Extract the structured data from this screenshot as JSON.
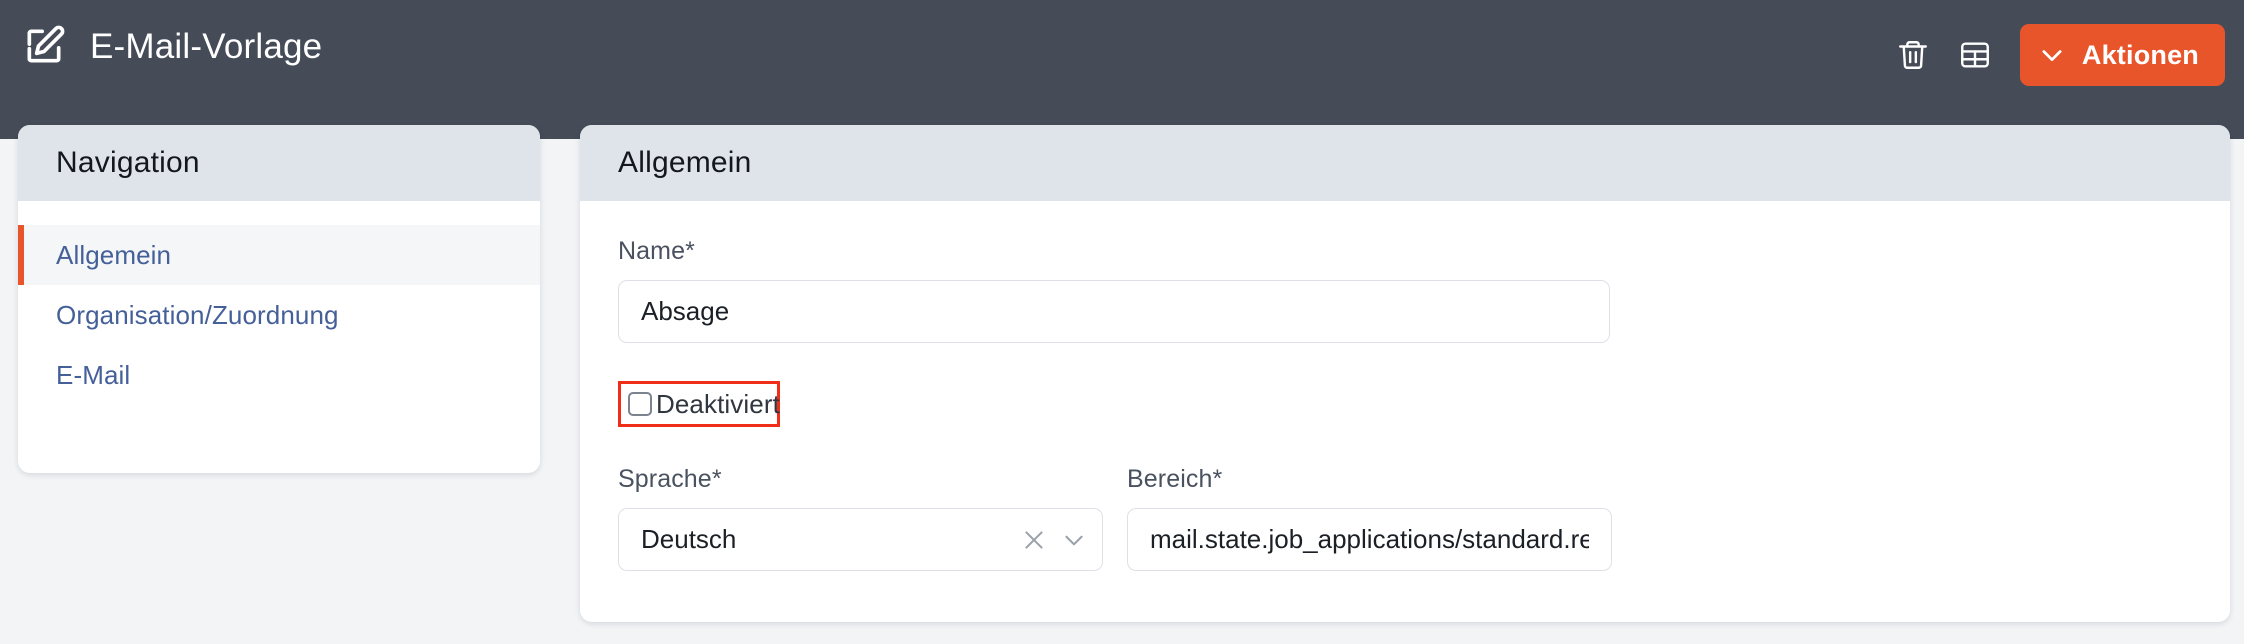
{
  "header": {
    "title": "E-Mail-Vorlage",
    "edit_icon": "edit-square-icon",
    "delete_icon": "trash-icon",
    "table_icon": "table-icon",
    "actions_label": "Aktionen",
    "actions_chevron_icon": "chevron-down-icon",
    "background_color": "#454c58",
    "accent_color": "#e8552a"
  },
  "navigation": {
    "title": "Navigation",
    "items": [
      {
        "label": "Allgemein",
        "active": true
      },
      {
        "label": "Organisation/Zuordnung",
        "active": false
      },
      {
        "label": "E-Mail",
        "active": false
      }
    ],
    "active_indicator_color": "#e8552a",
    "link_color": "#456099"
  },
  "main": {
    "title": "Allgemein",
    "fields": {
      "name": {
        "label": "Name*",
        "value": "Absage",
        "placeholder": ""
      },
      "deaktiviert": {
        "label": "Deaktiviert",
        "checked": false,
        "highlight_color": "#f02d16"
      },
      "sprache": {
        "label": "Sprache*",
        "value": "Deutsch",
        "clear_icon": "close-icon",
        "dropdown_icon": "chevron-down-icon"
      },
      "bereich": {
        "label": "Bereich*",
        "value": "mail.state.job_applications/standard.reject",
        "placeholder": ""
      }
    }
  }
}
